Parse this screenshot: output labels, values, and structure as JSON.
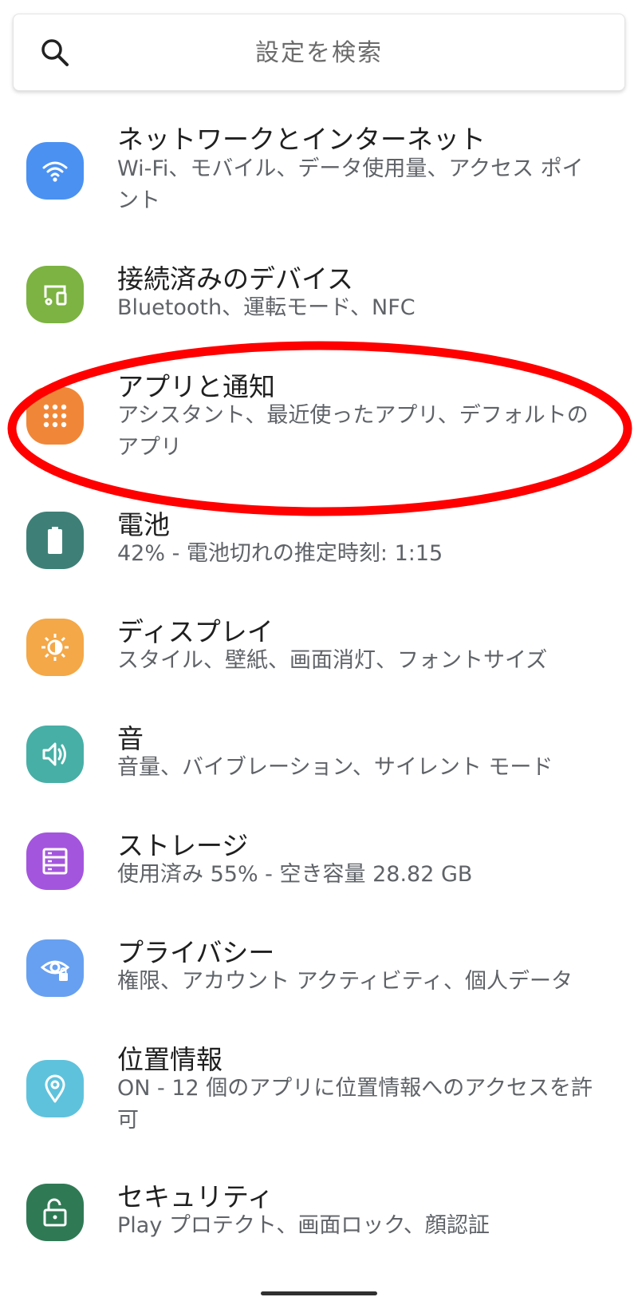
{
  "search": {
    "placeholder": "設定を検索",
    "icon": "search-icon"
  },
  "settings": [
    {
      "title": "ネットワークとインターネット",
      "subtitle": "Wi-Fi、モバイル、データ使用量、アクセス ポイント",
      "icon": "wifi-icon",
      "color": "#4a91f2"
    },
    {
      "title": "接続済みのデバイス",
      "subtitle": "Bluetooth、運転モード、NFC",
      "icon": "devices-icon",
      "color": "#7cb342"
    },
    {
      "title": "アプリと通知",
      "subtitle": "アシスタント、最近使ったアプリ、デフォルトのアプリ",
      "icon": "apps-grid-icon",
      "color": "#f08738"
    },
    {
      "title": "電池",
      "subtitle": "42% - 電池切れの推定時刻: 1:15",
      "icon": "battery-icon",
      "color": "#3e8077"
    },
    {
      "title": "ディスプレイ",
      "subtitle": "スタイル、壁紙、画面消灯、フォントサイズ",
      "icon": "brightness-icon",
      "color": "#f4a847"
    },
    {
      "title": "音",
      "subtitle": "音量、バイブレーション、サイレント モード",
      "icon": "sound-icon",
      "color": "#47afa6"
    },
    {
      "title": "ストレージ",
      "subtitle": "使用済み 55% - 空き容量 28.82 GB",
      "icon": "storage-icon",
      "color": "#a455de"
    },
    {
      "title": "プライバシー",
      "subtitle": "権限、アカウント アクティビティ、個人データ",
      "icon": "privacy-eye-icon",
      "color": "#67a0f0"
    },
    {
      "title": "位置情報",
      "subtitle": "ON - 12 個のアプリに位置情報へのアクセスを許可",
      "icon": "location-pin-icon",
      "color": "#5fc2dc"
    },
    {
      "title": "セキュリティ",
      "subtitle": "Play プロテクト、画面ロック、顔認証",
      "icon": "unlock-icon",
      "color": "#2f7a55"
    }
  ],
  "annotation": {
    "highlight_color": "#ff0000",
    "highlighted_item": "アプリと通知"
  }
}
